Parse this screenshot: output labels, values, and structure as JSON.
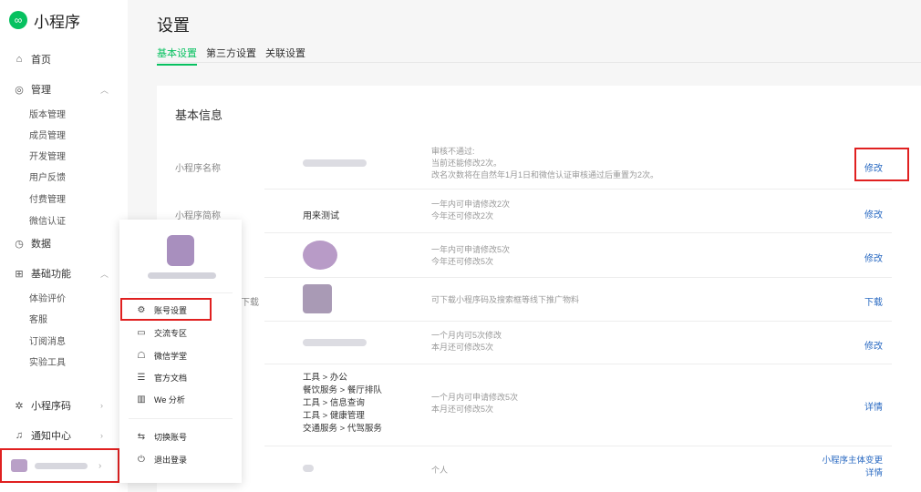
{
  "brand": {
    "logo_glyph": "∞",
    "name": "小程序"
  },
  "nav": {
    "home": "首页",
    "manage": "管理",
    "manage_items": [
      "版本管理",
      "成员管理",
      "开发管理",
      "用户反馈",
      "付费管理",
      "微信认证"
    ],
    "data": "数据",
    "features": "基础功能",
    "feature_items": [
      "体验评价",
      "客服",
      "订阅消息",
      "实验工具"
    ],
    "qrcode": "小程序码",
    "notifications": "通知中心"
  },
  "page": {
    "title": "设置"
  },
  "tabs": [
    "基本设置",
    "第三方设置",
    "关联设置"
  ],
  "card": {
    "title": "基本信息",
    "rows": [
      {
        "label": "小程序名称",
        "desc": [
          "审核不通过:",
          "当前还能修改2次。",
          "改名次数将在自然年1月1日和微信认证审核通过后重置为2次。"
        ],
        "action": "修改"
      },
      {
        "label": "小程序简称",
        "value": "用来测试",
        "desc": [
          "一年内可申请修改2次",
          "今年还可修改2次"
        ],
        "action": "修改"
      },
      {
        "desc": [
          "一年内可申请修改5次",
          "今年还可修改5次"
        ],
        "action": "修改"
      },
      {
        "label_tail": "下载",
        "desc": [
          "可下载小程序码及搜索框等线下推广物料"
        ],
        "action": "下载"
      },
      {
        "desc": [
          "一个月内可5次修改",
          "本月还可修改5次"
        ],
        "action": "修改"
      },
      {
        "values": [
          "工具 > 办公",
          "餐饮服务 > 餐厅排队",
          "工具 > 信息查询",
          "工具 > 健康管理",
          "交通服务 > 代驾服务"
        ],
        "desc": [
          "一个月内可申请修改5次",
          "本月还可修改5次"
        ],
        "action": "详情"
      },
      {
        "desc": [
          "个人"
        ],
        "actions": [
          "小程序主体变更",
          "详情"
        ]
      }
    ]
  },
  "popup": {
    "items": [
      "账号设置",
      "交流专区",
      "微信学堂",
      "官方文档",
      "We 分析"
    ],
    "bottom_items": [
      "切换账号",
      "退出登录"
    ]
  },
  "colors": {
    "accent": "#07c160",
    "link": "#2a6ac2",
    "highlight": "#e02020"
  }
}
